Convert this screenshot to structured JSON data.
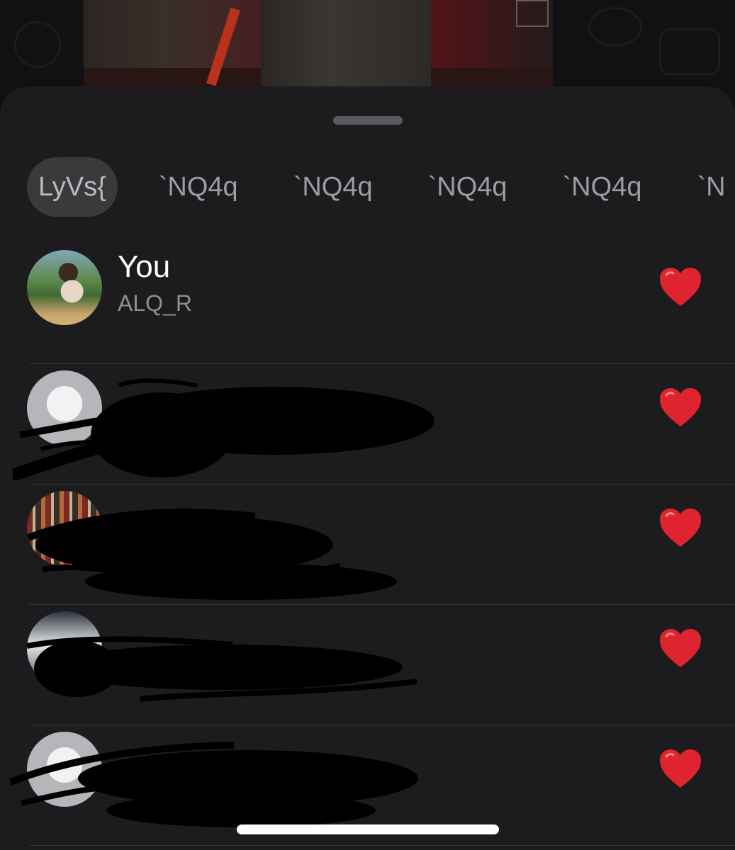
{
  "reaction_tabs": [
    {
      "label": "LyVs{",
      "active": true
    },
    {
      "label": "`NQ4q",
      "active": false
    },
    {
      "label": "`NQ4q",
      "active": false
    },
    {
      "label": "`NQ4q",
      "active": false
    },
    {
      "label": "`NQ4q",
      "active": false
    },
    {
      "label": "`N",
      "active": false
    }
  ],
  "reactions": [
    {
      "name": "You",
      "subtitle": "ALQ_R",
      "reaction": "red-heart",
      "avatar": "photo"
    },
    {
      "name": "",
      "subtitle": "",
      "reaction": "red-heart",
      "avatar": "default",
      "redacted": true
    },
    {
      "name": "",
      "subtitle": "",
      "reaction": "red-heart",
      "avatar": "photo",
      "redacted": true
    },
    {
      "name": "",
      "subtitle": "",
      "reaction": "red-heart",
      "avatar": "photo",
      "redacted": true
    },
    {
      "name": "",
      "subtitle": "",
      "reaction": "red-heart",
      "avatar": "default",
      "redacted": true
    }
  ],
  "colors": {
    "sheet_background": "#1c1c1e",
    "active_tab_background": "#3a3a3d",
    "heart": "#e0242f",
    "divider": "#38383a"
  }
}
